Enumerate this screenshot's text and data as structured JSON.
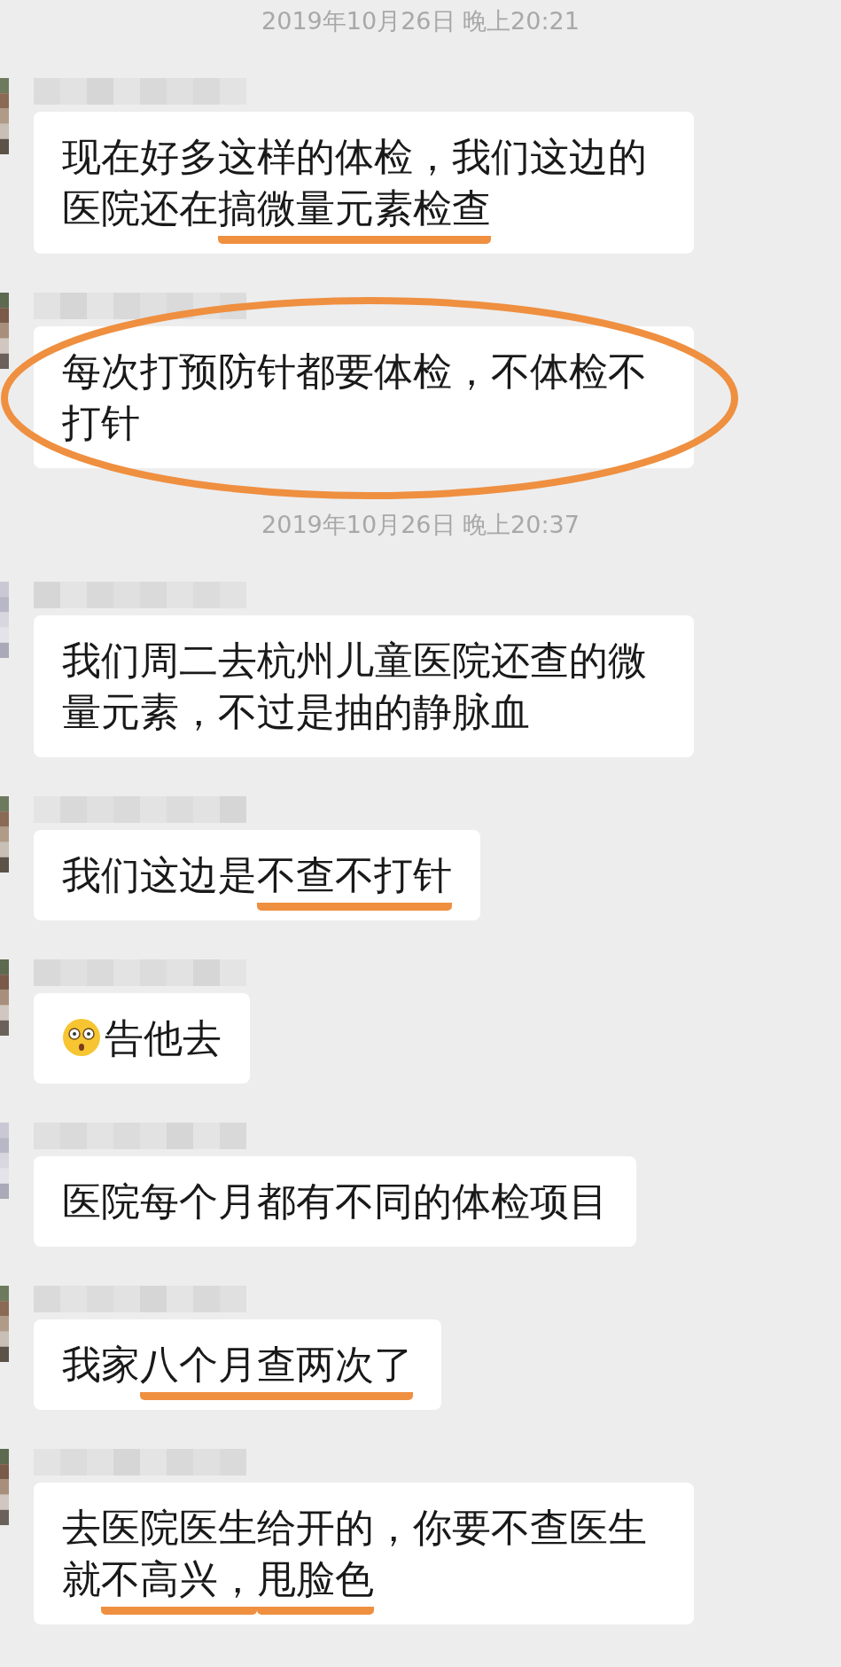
{
  "items": [
    {
      "kind": "timestamp",
      "text": "2019年10月26日 晚上20:21"
    },
    {
      "kind": "message",
      "circled": false,
      "segments": [
        {
          "kind": "text",
          "text": "现在好多这样的体检，我们这边的医院还在",
          "underlined": false
        },
        {
          "kind": "text",
          "text": "搞微量元素检查",
          "underlined": true
        }
      ]
    },
    {
      "kind": "message",
      "circled": true,
      "segments": [
        {
          "kind": "text",
          "text": "每次打预防针都要体检，不体检不打针",
          "underlined": false
        }
      ]
    },
    {
      "kind": "timestamp",
      "text": "2019年10月26日 晚上20:37"
    },
    {
      "kind": "message",
      "circled": false,
      "segments": [
        {
          "kind": "text",
          "text": "我们周二去杭州儿童医院还查的微量元素，不过是抽的静脉血",
          "underlined": false
        }
      ]
    },
    {
      "kind": "message",
      "circled": false,
      "segments": [
        {
          "kind": "text",
          "text": "我们这边是",
          "underlined": false
        },
        {
          "kind": "text",
          "text": "不查不打针",
          "underlined": true
        }
      ]
    },
    {
      "kind": "message",
      "circled": false,
      "segments": [
        {
          "kind": "emoji"
        },
        {
          "kind": "text",
          "text": "告他去",
          "underlined": false
        }
      ]
    },
    {
      "kind": "message",
      "circled": false,
      "segments": [
        {
          "kind": "text",
          "text": "医院每个月都有不同的体检项目",
          "underlined": false
        }
      ]
    },
    {
      "kind": "message",
      "circled": false,
      "segments": [
        {
          "kind": "text",
          "text": "我家",
          "underlined": false
        },
        {
          "kind": "text",
          "text": "八个月查两次了",
          "underlined": true
        }
      ]
    },
    {
      "kind": "message",
      "circled": false,
      "segments": [
        {
          "kind": "text",
          "text": "去医院医生给开的，你要不查医生就",
          "underlined": false
        },
        {
          "kind": "text",
          "text": "不高兴，",
          "underlined": true
        },
        {
          "kind": "text",
          "text": "甩脸色",
          "underlined": true
        }
      ]
    }
  ]
}
